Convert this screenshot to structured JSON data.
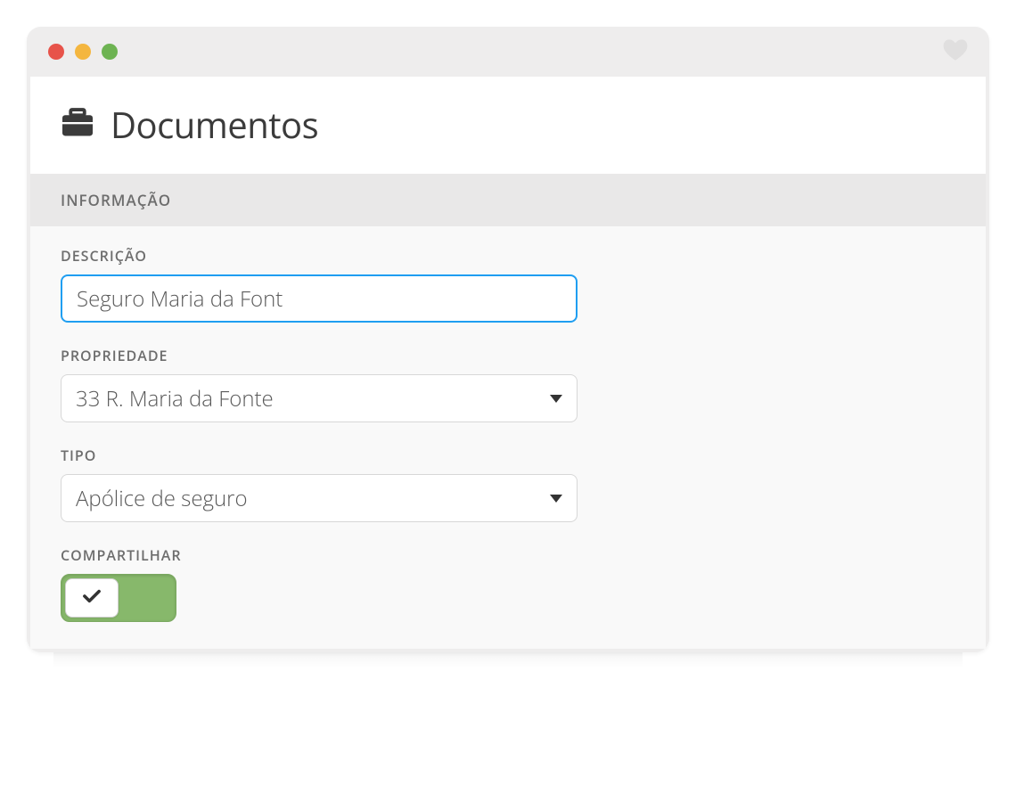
{
  "header": {
    "title": "Documentos"
  },
  "section": {
    "label": "INFORMAÇÃO"
  },
  "form": {
    "description": {
      "label": "DESCRIÇÃO",
      "value": "Seguro Maria da Font"
    },
    "property": {
      "label": "PROPRIEDADE",
      "selected": "33 R. Maria da Fonte"
    },
    "type": {
      "label": "TIPO",
      "selected": "Apólice de seguro"
    },
    "share": {
      "label": "COMPARTILHAR",
      "enabled": true
    }
  },
  "colors": {
    "accent_focus": "#1f9ef1",
    "toggle_on": "#87b86b"
  }
}
